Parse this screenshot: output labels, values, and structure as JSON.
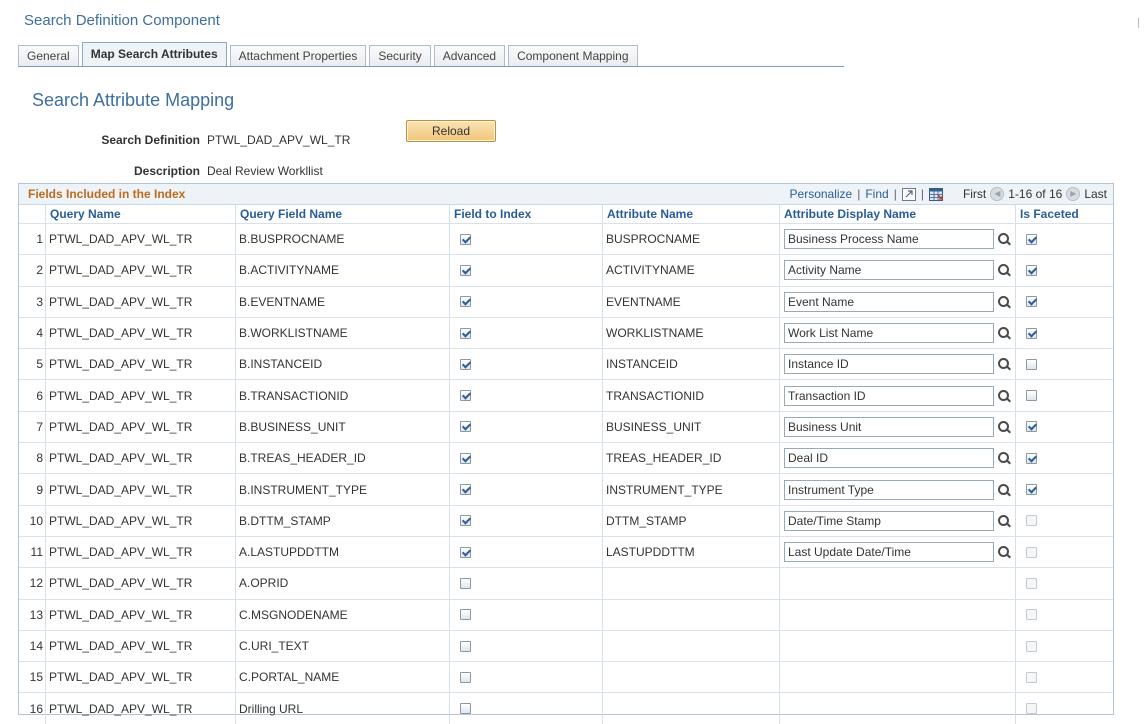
{
  "page": {
    "title": "Search Definition Component"
  },
  "tabs": [
    {
      "label": "General",
      "active": false
    },
    {
      "label": "Map Search Attributes",
      "active": true
    },
    {
      "label": "Attachment Properties",
      "active": false
    },
    {
      "label": "Security",
      "active": false
    },
    {
      "label": "Advanced",
      "active": false
    },
    {
      "label": "Component Mapping",
      "active": false
    }
  ],
  "section": {
    "heading": "Search Attribute Mapping"
  },
  "fields": {
    "search_definition_label": "Search Definition",
    "search_definition_value": "PTWL_DAD_APV_WL_TR",
    "reload_label": "Reload",
    "description_label": "Description",
    "description_value": "Deal Review Workllist"
  },
  "grid": {
    "title": "Fields Included in the Index",
    "personalize_label": "Personalize",
    "find_label": "Find",
    "first_label": "First",
    "range_label": "1-16 of 16",
    "last_label": "Last",
    "columns": [
      "Query Name",
      "Query Field Name",
      "Field to Index",
      "Attribute Name",
      "Attribute Display Name",
      "Is Faceted"
    ],
    "rows": [
      {
        "num": "1",
        "query": "PTWL_DAD_APV_WL_TR",
        "field": "B.BUSPROCNAME",
        "indexed": true,
        "attr": "BUSPROCNAME",
        "display": "Business Process Name",
        "faceted": true,
        "facet_enabled": true
      },
      {
        "num": "2",
        "query": "PTWL_DAD_APV_WL_TR",
        "field": "B.ACTIVITYNAME",
        "indexed": true,
        "attr": "ACTIVITYNAME",
        "display": "Activity Name",
        "faceted": true,
        "facet_enabled": true
      },
      {
        "num": "3",
        "query": "PTWL_DAD_APV_WL_TR",
        "field": "B.EVENTNAME",
        "indexed": true,
        "attr": "EVENTNAME",
        "display": "Event Name",
        "faceted": true,
        "facet_enabled": true
      },
      {
        "num": "4",
        "query": "PTWL_DAD_APV_WL_TR",
        "field": "B.WORKLISTNAME",
        "indexed": true,
        "attr": "WORKLISTNAME",
        "display": "Work List Name",
        "faceted": true,
        "facet_enabled": true
      },
      {
        "num": "5",
        "query": "PTWL_DAD_APV_WL_TR",
        "field": "B.INSTANCEID",
        "indexed": true,
        "attr": "INSTANCEID",
        "display": "Instance ID",
        "faceted": false,
        "facet_enabled": true
      },
      {
        "num": "6",
        "query": "PTWL_DAD_APV_WL_TR",
        "field": "B.TRANSACTIONID",
        "indexed": true,
        "attr": "TRANSACTIONID",
        "display": "Transaction ID",
        "faceted": false,
        "facet_enabled": true
      },
      {
        "num": "7",
        "query": "PTWL_DAD_APV_WL_TR",
        "field": "B.BUSINESS_UNIT",
        "indexed": true,
        "attr": "BUSINESS_UNIT",
        "display": "Business Unit",
        "faceted": true,
        "facet_enabled": true
      },
      {
        "num": "8",
        "query": "PTWL_DAD_APV_WL_TR",
        "field": "B.TREAS_HEADER_ID",
        "indexed": true,
        "attr": "TREAS_HEADER_ID",
        "display": "Deal ID",
        "faceted": true,
        "facet_enabled": true
      },
      {
        "num": "9",
        "query": "PTWL_DAD_APV_WL_TR",
        "field": "B.INSTRUMENT_TYPE",
        "indexed": true,
        "attr": "INSTRUMENT_TYPE",
        "display": "Instrument Type",
        "faceted": true,
        "facet_enabled": true
      },
      {
        "num": "10",
        "query": "PTWL_DAD_APV_WL_TR",
        "field": "B.DTTM_STAMP",
        "indexed": true,
        "attr": "DTTM_STAMP",
        "display": "Date/Time Stamp",
        "faceted": false,
        "facet_enabled": false
      },
      {
        "num": "11",
        "query": "PTWL_DAD_APV_WL_TR",
        "field": "A.LASTUPDDTTM",
        "indexed": true,
        "attr": "LASTUPDDTTM",
        "display": "Last Update Date/Time",
        "faceted": false,
        "facet_enabled": false
      },
      {
        "num": "12",
        "query": "PTWL_DAD_APV_WL_TR",
        "field": "A.OPRID",
        "indexed": false,
        "attr": "",
        "display": "",
        "faceted": false,
        "facet_enabled": false
      },
      {
        "num": "13",
        "query": "PTWL_DAD_APV_WL_TR",
        "field": "C.MSGNODENAME",
        "indexed": false,
        "attr": "",
        "display": "",
        "faceted": false,
        "facet_enabled": false
      },
      {
        "num": "14",
        "query": "PTWL_DAD_APV_WL_TR",
        "field": "C.URI_TEXT",
        "indexed": false,
        "attr": "",
        "display": "",
        "faceted": false,
        "facet_enabled": false
      },
      {
        "num": "15",
        "query": "PTWL_DAD_APV_WL_TR",
        "field": "C.PORTAL_NAME",
        "indexed": false,
        "attr": "",
        "display": "",
        "faceted": false,
        "facet_enabled": false
      },
      {
        "num": "16",
        "query": "PTWL_DAD_APV_WL_TR",
        "field": "Drilling URL",
        "indexed": false,
        "attr": "",
        "display": "",
        "faceted": false,
        "facet_enabled": false
      }
    ]
  },
  "icons": {
    "view_all": "grid-zoom-icon",
    "download": "download-spreadsheet-icon",
    "prev": "previous-arrow-icon",
    "next": "next-arrow-icon",
    "lookup": "lookup-magnifier-icon"
  },
  "colors": {
    "title_blue": "#3e6e9e",
    "grid_title_orange": "#c06a1e",
    "link_blue": "#2a5d96",
    "reload_button": "#f0c67a"
  }
}
